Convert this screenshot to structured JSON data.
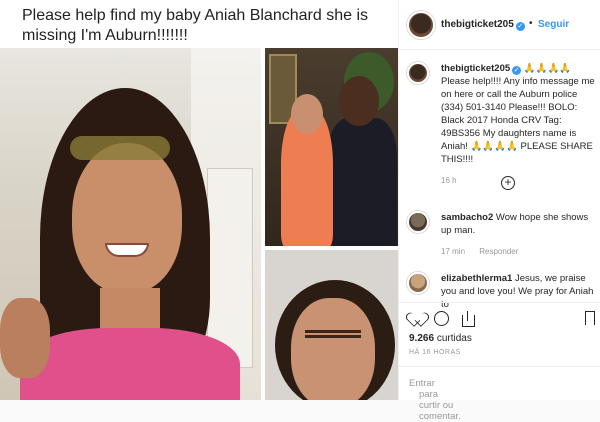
{
  "media": {
    "caption_text": "Please help find my baby Aniah Blanchard she is missing I'm Auburn!!!!!!!"
  },
  "header": {
    "username": "thebigticket205",
    "verified_glyph": "✓",
    "separator": "•",
    "follow_label": "Seguir"
  },
  "post_caption": {
    "username": "thebigticket205",
    "verified_glyph": "✓",
    "text": "🙏🙏🙏🙏Please help!!!! Any info message me on here or call the Auburn police (334) 501-3140 Please!!! BOLO: Black 2017 Honda CRV Tag: 49BS356 My daughters name is Aniah! 🙏🙏🙏🙏 PLEASE SHARE THIS!!!!",
    "time": "16 h"
  },
  "load_more_glyph": "+",
  "comments": [
    {
      "username": "sambacho2",
      "text": "Wow hope she shows up man.",
      "time": "17 min",
      "reply": "Responder"
    },
    {
      "username": "elizabethlerma1",
      "text": "Jesus, we praise you and love you! We pray for Aniah to"
    }
  ],
  "actions": {
    "like_icon": "heart-icon",
    "comment_icon": "comment-icon",
    "share_icon": "share-icon",
    "save_icon": "bookmark-icon"
  },
  "stats": {
    "likes_count": "9.266",
    "likes_word": "curtidas",
    "posted_ago": "HÁ 16 HORAS"
  },
  "comment_box": {
    "login_text": "Entrar",
    "rest_text": " para curtir ou comentar."
  }
}
